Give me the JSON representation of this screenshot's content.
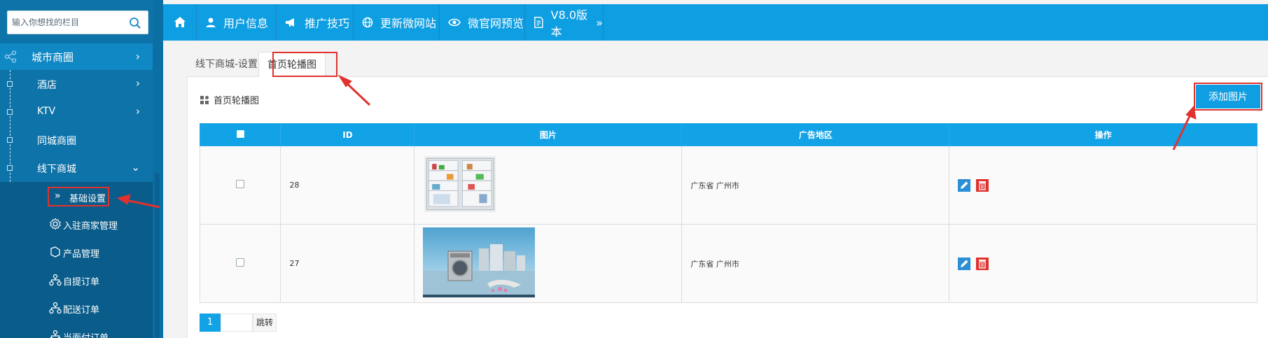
{
  "sidebar": {
    "search_placeholder": "输入你想找的栏目",
    "top_menu": "城市商圈",
    "items": [
      {
        "label": "酒店"
      },
      {
        "label": "KTV"
      },
      {
        "label": "同城商圈"
      },
      {
        "label": "线下商城"
      }
    ],
    "sub_items": [
      {
        "label": "基础设置"
      },
      {
        "label": "入驻商家管理"
      },
      {
        "label": "产品管理"
      },
      {
        "label": "自提订单"
      },
      {
        "label": "配送订单"
      },
      {
        "label": "当面付订单"
      }
    ]
  },
  "topnav": {
    "items": [
      {
        "label": "用户信息"
      },
      {
        "label": "推广技巧"
      },
      {
        "label": "更新微网站"
      },
      {
        "label": "微官网预览"
      },
      {
        "label": "V8.0版本"
      }
    ]
  },
  "tabs": [
    {
      "label": "线下商城-设置"
    },
    {
      "label": "首页轮播图"
    }
  ],
  "panel": {
    "title": "首页轮播图",
    "add_button": "添加图片"
  },
  "table": {
    "headers": [
      "",
      "ID",
      "图片",
      "广告地区",
      "操作"
    ],
    "rows": [
      {
        "id": "28",
        "region": "广东省 广州市",
        "image": "refrigerator"
      },
      {
        "id": "27",
        "region": "广东省 广州市",
        "image": "washing-machine"
      }
    ]
  },
  "pager": {
    "current": "1",
    "go_label": "跳转"
  },
  "colors": {
    "accent": "#0e9ee2",
    "sidebar": "#0e73a8",
    "highlight": "#e0322e"
  }
}
